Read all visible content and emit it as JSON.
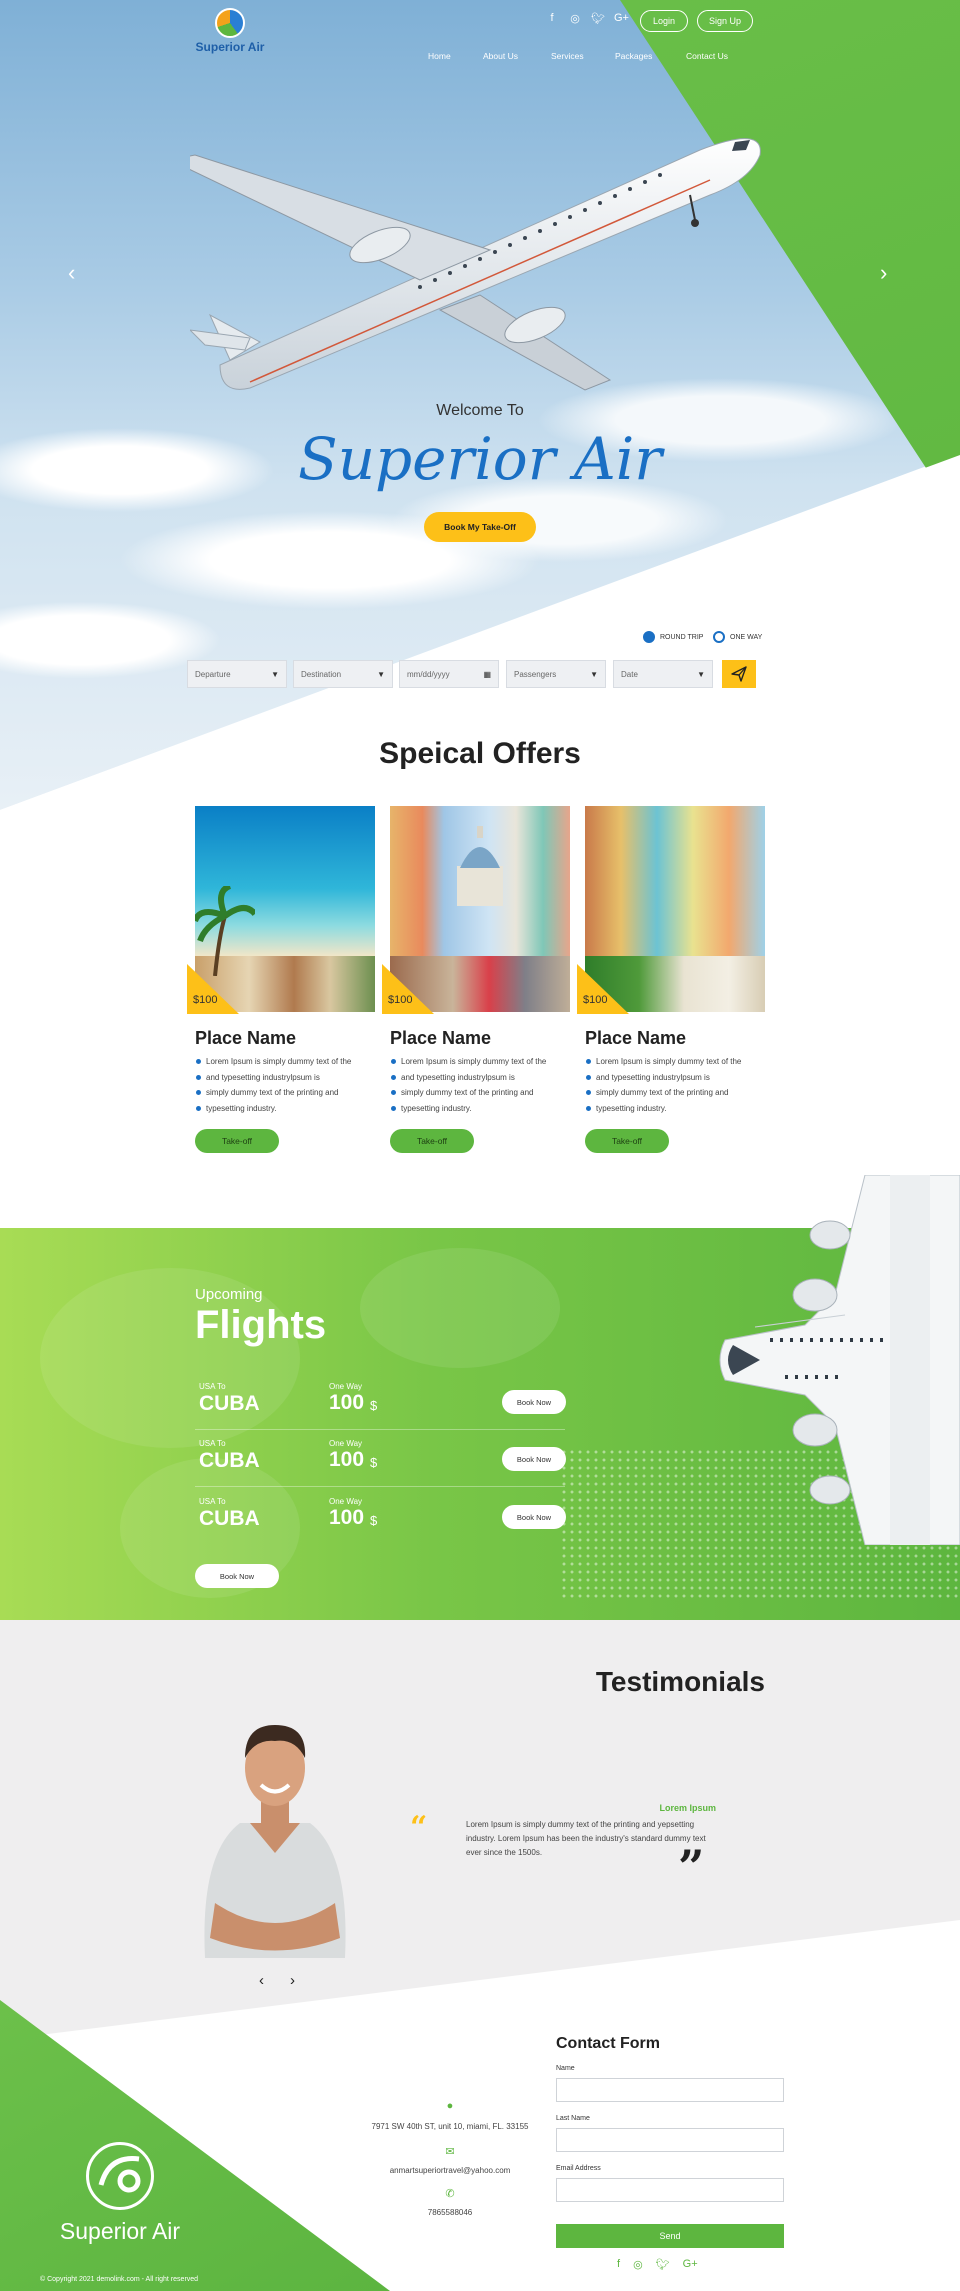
{
  "brand": {
    "name": "Superior Air"
  },
  "header": {
    "socials": [
      {
        "name": "facebook-icon",
        "glyph": "f"
      },
      {
        "name": "instagram-icon",
        "glyph": "◎"
      },
      {
        "name": "twitter-icon",
        "glyph": "🐦︎"
      },
      {
        "name": "google-plus-icon",
        "glyph": "G+"
      }
    ],
    "login_label": "Login",
    "signup_label": "Sign Up",
    "nav": [
      "Home",
      "About Us",
      "Services",
      "Packages",
      "Contact Us"
    ]
  },
  "hero": {
    "welcome": "Welcome To",
    "title": "Superior Air",
    "cta_label": "Book My Take-Off",
    "prev_icon": "chevron-left-icon",
    "next_icon": "chevron-right-icon"
  },
  "search": {
    "round_trip_label": "ROUND TRIP",
    "one_way_label": "ONE WAY",
    "selected_trip": "round_trip",
    "departure": "Departure",
    "destination": "Destination",
    "date_placeholder": "mm/dd/yyyy",
    "passengers": "Passengers",
    "date": "Date",
    "submit_icon": "paper-plane-icon"
  },
  "offers": {
    "title": "Speical Offers",
    "cards": [
      {
        "price": "$100",
        "name": "Place Name",
        "bullets": [
          "Lorem Ipsum is simply dummy text of the",
          "and typesetting industrylpsum is",
          "simply dummy text of the printing and",
          "typesetting industry."
        ],
        "button": "Take-off"
      },
      {
        "price": "$100",
        "name": "Place Name",
        "bullets": [
          "Lorem Ipsum is simply dummy text of the",
          "and typesetting industrylpsum is",
          "simply dummy text of the printing and",
          "typesetting industry."
        ],
        "button": "Take-off"
      },
      {
        "price": "$100",
        "name": "Place Name",
        "bullets": [
          "Lorem Ipsum is simply dummy text of the",
          "and typesetting industrylpsum is",
          "simply dummy text of the printing and",
          "typesetting industry."
        ],
        "button": "Take-off"
      }
    ]
  },
  "flights": {
    "upcoming": "Upcoming",
    "title": "Flights",
    "rows": [
      {
        "from_label": "USA To",
        "dest": "CUBA",
        "way": "One Way",
        "price": "100",
        "currency": "$",
        "button": "Book Now"
      },
      {
        "from_label": "USA To",
        "dest": "CUBA",
        "way": "One Way",
        "price": "100",
        "currency": "$",
        "button": "Book Now"
      },
      {
        "from_label": "USA To",
        "dest": "CUBA",
        "way": "One Way",
        "price": "100",
        "currency": "$",
        "button": "Book Now"
      }
    ],
    "book_all": "Book Now"
  },
  "testimonials": {
    "title": "Testimonials",
    "name": "Lorem Ipsum",
    "text": "Lorem Ipsum is simply dummy text of the printing and yepsetting industry. Lorem Ipsum has been the industry's standard dummy text ever since the 1500s.",
    "prev": "‹",
    "next": "›"
  },
  "contact": {
    "address": "7971 SW 40th ST, unit 10, miami, FL. 33155",
    "email": "anmartsuperiortravel@yahoo.com",
    "phone": "7865588046",
    "form_title": "Contact Form",
    "name_label": "Name",
    "last_name_label": "Last Name",
    "email_label": "Email Address",
    "send_label": "Send"
  },
  "footer": {
    "brand": "Superior Air",
    "copyright": "© Copyright 2021 demolink.com - All right reserved",
    "socials": [
      {
        "name": "facebook-icon",
        "glyph": "f"
      },
      {
        "name": "instagram-icon",
        "glyph": "◎"
      },
      {
        "name": "twitter-icon",
        "glyph": "🐦︎"
      },
      {
        "name": "google-plus-icon",
        "glyph": "G+"
      }
    ]
  },
  "colors": {
    "green": "#5db63f",
    "yellow": "#fdc018",
    "blue": "#1a6fc4"
  }
}
